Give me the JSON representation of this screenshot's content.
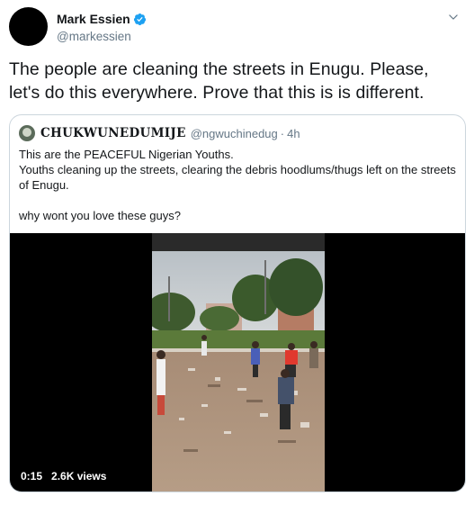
{
  "tweet": {
    "author_name": "Mark Essien",
    "author_handle": "@markessien",
    "text": "The people are cleaning the streets in Enugu. Please, let's do this everywhere. Prove that this is is different.",
    "verified_icon": "verified-badge-icon",
    "menu_icon": "chevron-down-icon"
  },
  "quote": {
    "author_name": "CHUKWUNEDUMIJE",
    "author_handle": "@ngwuchinedug",
    "separator": "·",
    "time": "4h",
    "lines": [
      "This are the PEACEFUL Nigerian Youths.",
      "Youths cleaning up the streets, clearing the debris hoodlums/thugs left on the streets of Enugu."
    ],
    "line_last": "why wont you love these guys?"
  },
  "video": {
    "duration": "0:15",
    "views": "2.6K views"
  },
  "colors": {
    "text": "#14171a",
    "secondary": "#657786",
    "verified": "#1da1f2",
    "border": "#ccd6dd"
  }
}
